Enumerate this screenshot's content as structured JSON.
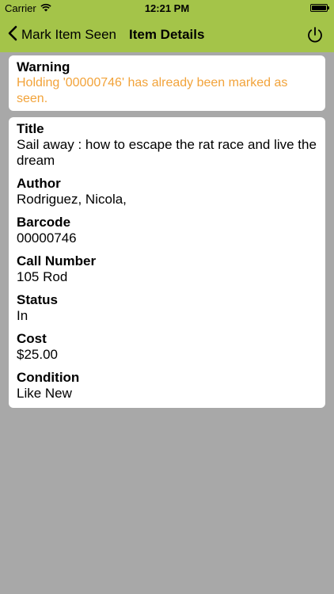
{
  "status_bar": {
    "carrier": "Carrier",
    "time": "12:21 PM"
  },
  "nav": {
    "back_label": "Mark Item Seen",
    "title": "Item Details"
  },
  "warning": {
    "label": "Warning",
    "message": "Holding '00000746' has already been marked as seen."
  },
  "details": {
    "fields": [
      {
        "label": "Title",
        "value": "Sail away : how to escape the rat race and live the dream"
      },
      {
        "label": "Author",
        "value": "Rodriguez, Nicola,"
      },
      {
        "label": "Barcode",
        "value": "00000746"
      },
      {
        "label": "Call Number",
        "value": "105 Rod"
      },
      {
        "label": "Status",
        "value": "In"
      },
      {
        "label": "Cost",
        "value": "$25.00"
      },
      {
        "label": "Condition",
        "value": "Like New"
      }
    ]
  },
  "colors": {
    "nav_background": "#a4c449",
    "warning_text": "#f2a33a",
    "background": "#a8a8a8"
  }
}
